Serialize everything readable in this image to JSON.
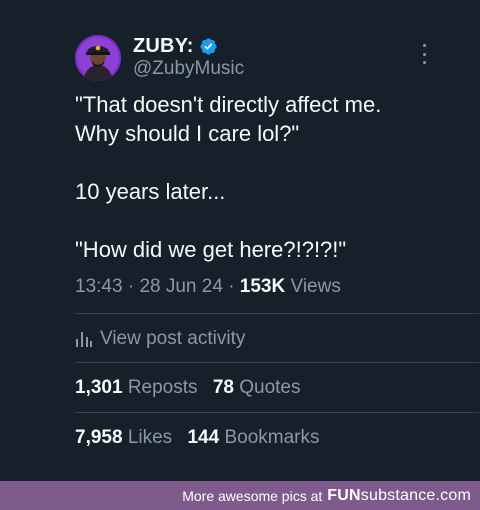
{
  "colors": {
    "background": "#15202b",
    "text_primary": "#f7f9f9",
    "text_secondary": "#8b98a5",
    "divider": "#38444d",
    "verified_badge": "#1d9bf0",
    "avatar_bg": "#7b2fbf",
    "footer_bg": "#7e5b8c"
  },
  "author": {
    "display_name": "ZUBY:",
    "handle": "@ZubyMusic",
    "verified_icon": "verified-badge-icon"
  },
  "tweet": {
    "lines": [
      "\"That doesn't directly affect me.",
      "Why should I care lol?\"",
      "",
      "10 years later...",
      "",
      "\"How did we get here?!?!?!\""
    ],
    "time": "13:43",
    "date": "28 Jun 24",
    "views_count": "153K",
    "views_label": "Views",
    "separator": "·"
  },
  "activity": {
    "icon": "bar-chart-icon",
    "label": "View post activity"
  },
  "stats": {
    "reposts_count": "1,301",
    "reposts_label": "Reposts",
    "quotes_count": "78",
    "quotes_label": "Quotes",
    "likes_count": "7,958",
    "likes_label": "Likes",
    "bookmarks_count": "144",
    "bookmarks_label": "Bookmarks"
  },
  "footer": {
    "text": "More awesome pics at",
    "brand_fun": "FUN",
    "brand_substance": "substance",
    "brand_suffix": ".com"
  }
}
